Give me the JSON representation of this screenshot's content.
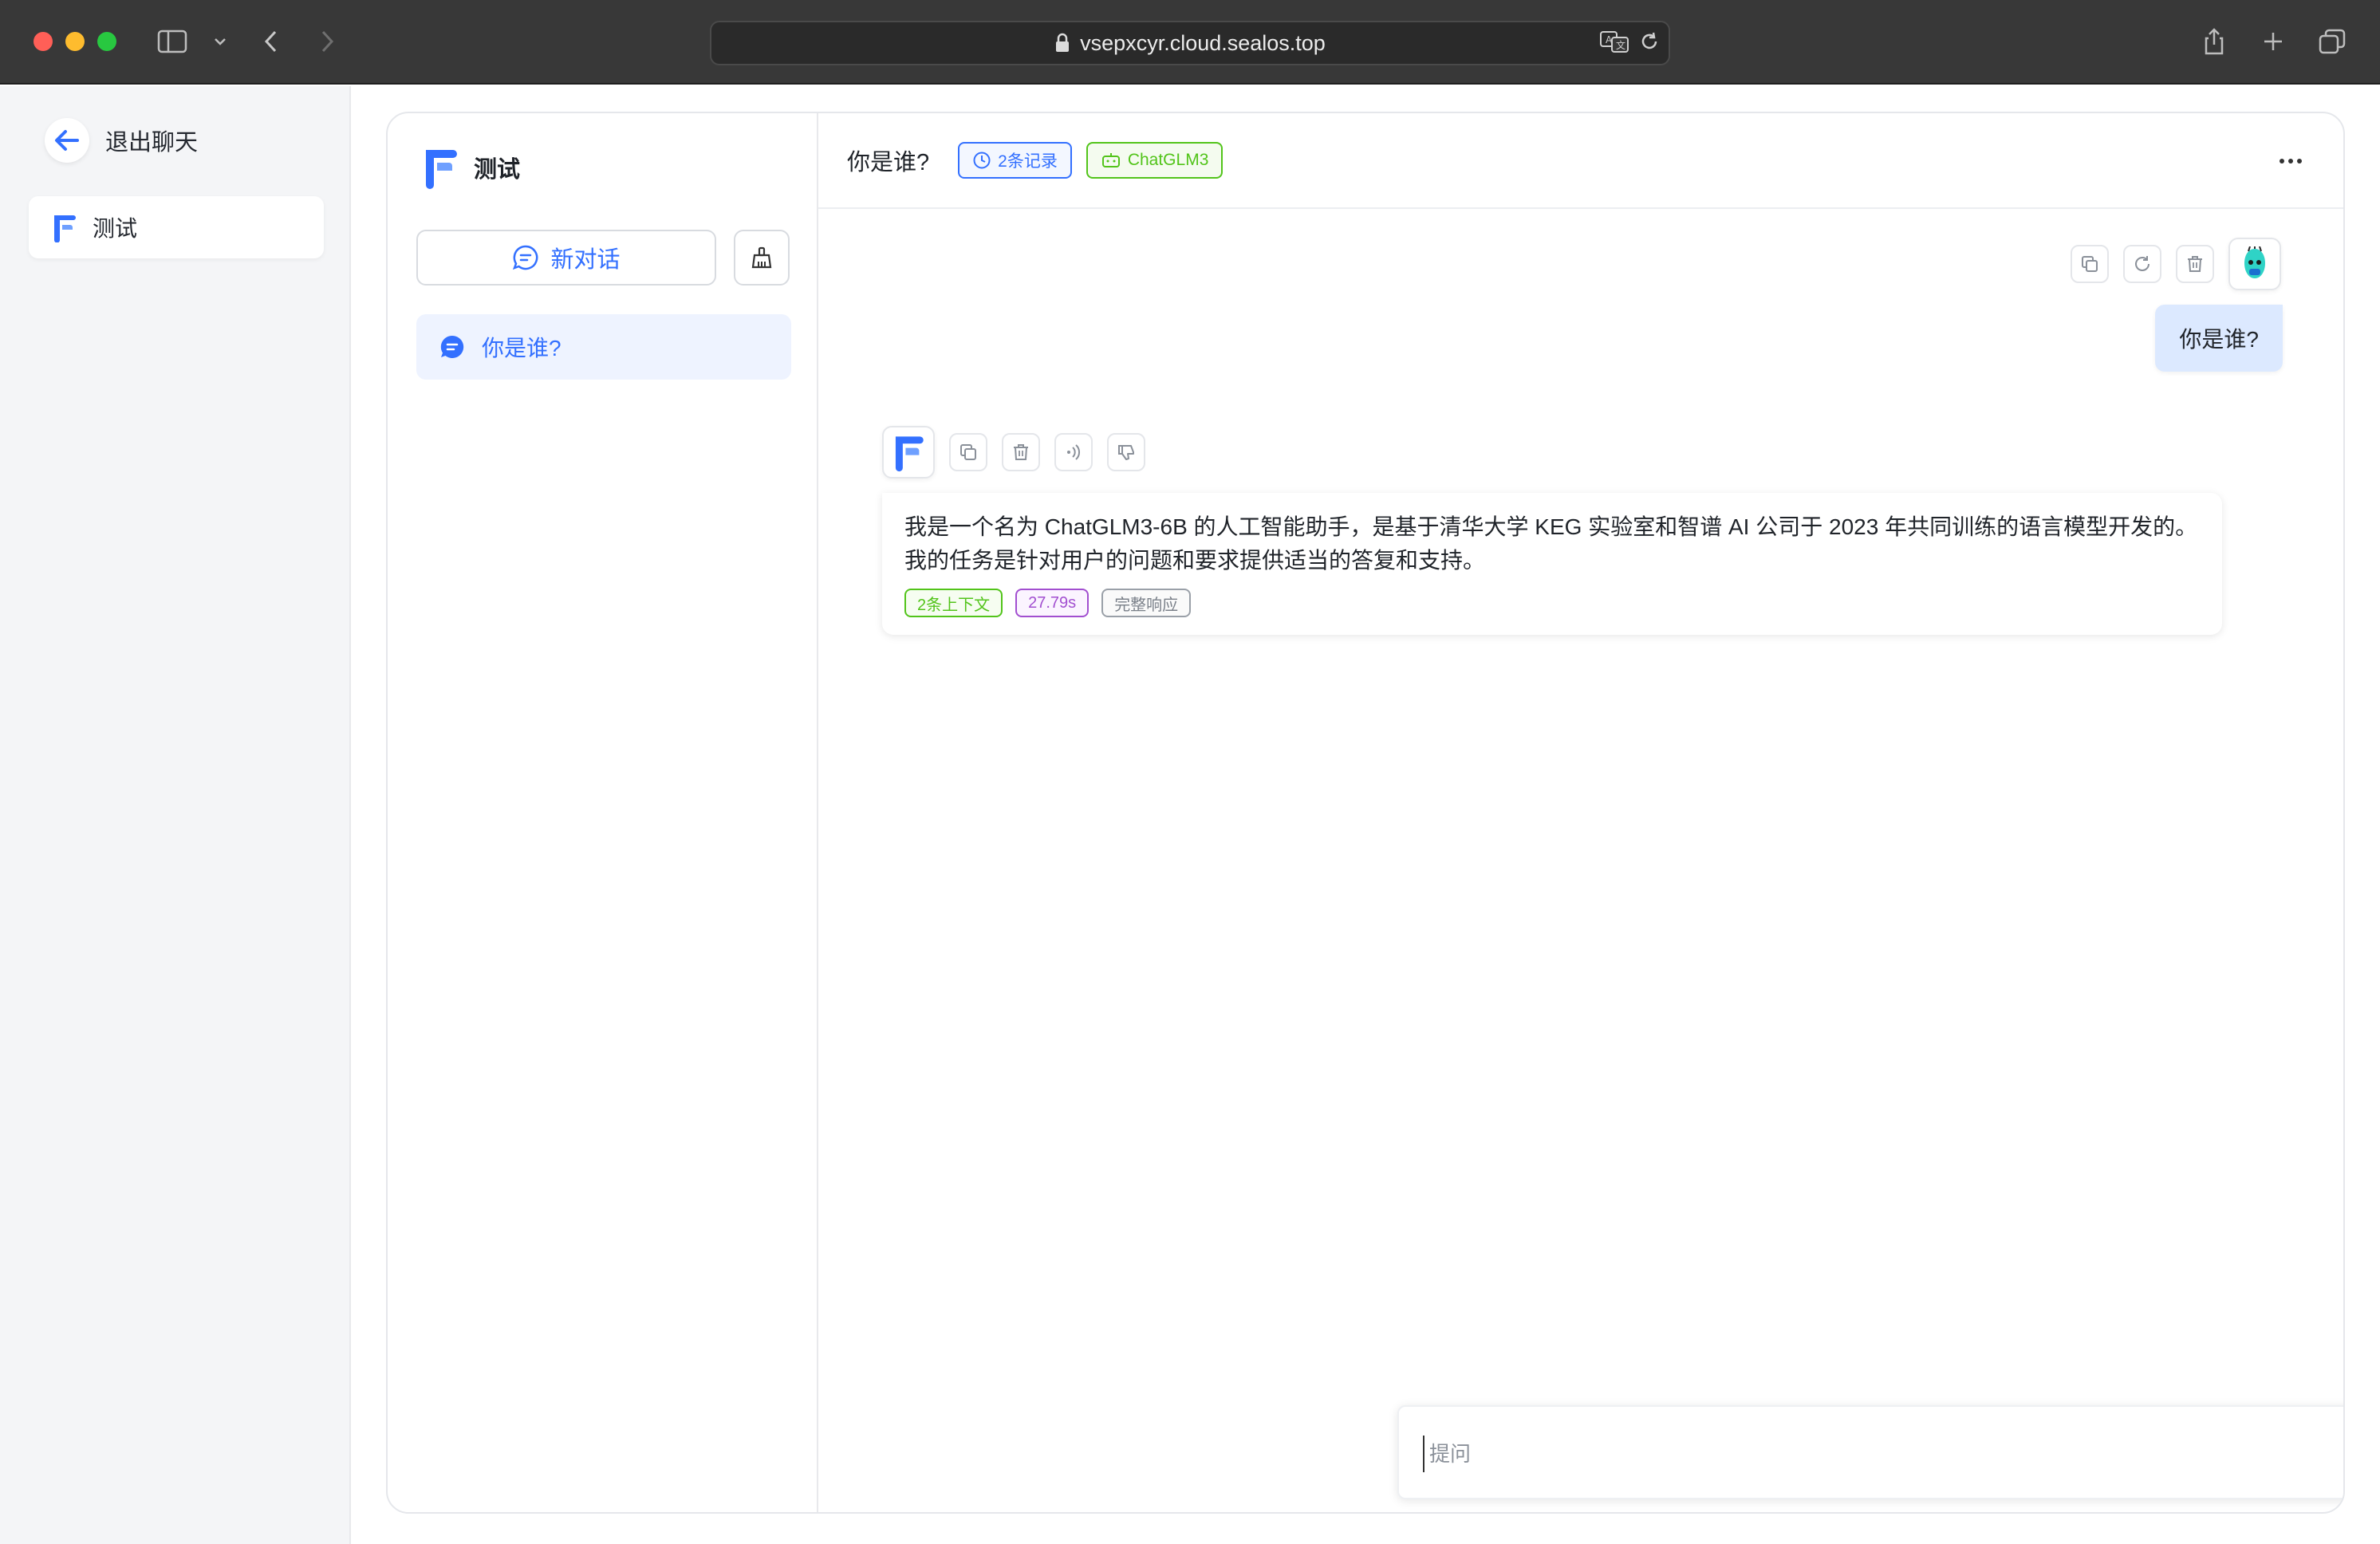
{
  "browser": {
    "url": "vsepxcyr.cloud.sealos.top"
  },
  "sidebar": {
    "exit_label": "退出聊天",
    "apps": [
      {
        "label": "测试"
      }
    ]
  },
  "history": {
    "app_name": "测试",
    "new_chat_label": "新对话",
    "items": [
      {
        "label": "你是谁?"
      }
    ]
  },
  "chat": {
    "title": "你是谁?",
    "records_tag": "2条记录",
    "model_tag": "ChatGLM3",
    "user_message": "你是谁?",
    "ai_message": "我是一个名为 ChatGLM3-6B 的人工智能助手，是基于清华大学 KEG 实验室和智谱 AI 公司于 2023 年共同训练的语言模型开发的。我的任务是针对用户的问题和要求提供适当的答复和支持。",
    "ai_tags": {
      "context": "2条上下文",
      "time": "27.79s",
      "full": "完整响应"
    },
    "input_placeholder": "提问"
  },
  "colors": {
    "accent": "#3370ff",
    "green": "#52c41a",
    "purple": "#a24fd0"
  }
}
